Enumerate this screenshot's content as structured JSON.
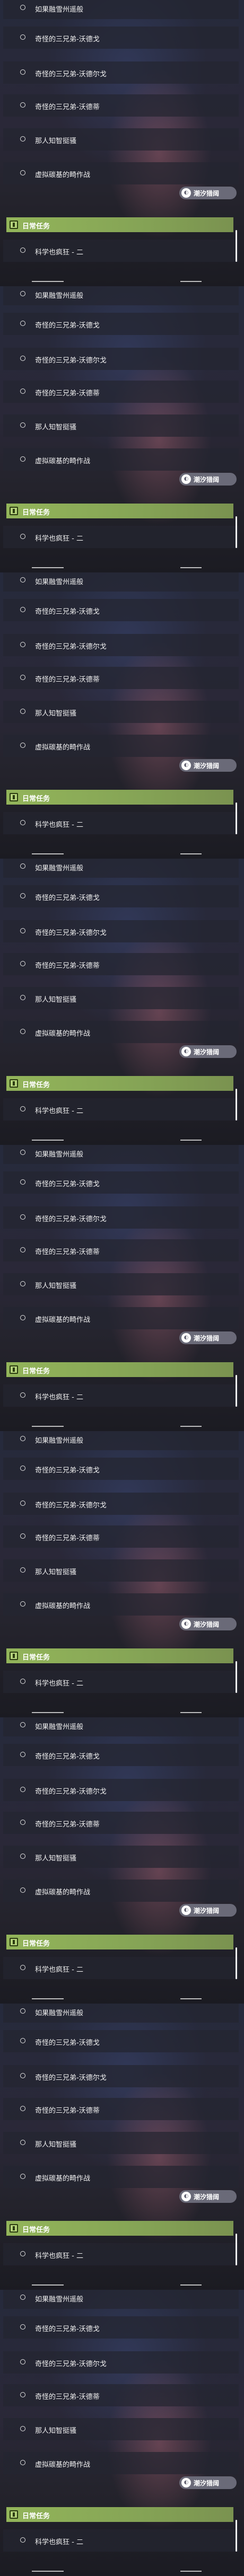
{
  "tasks": [
    "如果融雪州遥般",
    "奇怪的三兄弟-沃德戈",
    "奇怪的三兄弟-沃德尔戈",
    "奇怪的三兄弟-沃德蒂",
    "那人知智挺骚",
    "虚拟碳基的畸作战"
  ],
  "daily_header": "日常任务",
  "daily_task": "科学也疯狂 - 二",
  "badge_text": "潮汐猎阔",
  "colors": {
    "header_green": "#93b55a",
    "badge_bg": "#6a6a78"
  },
  "icons": {
    "task_status": "ring-icon",
    "badge": "circle-logo-icon",
    "header": "calendar-icon"
  }
}
